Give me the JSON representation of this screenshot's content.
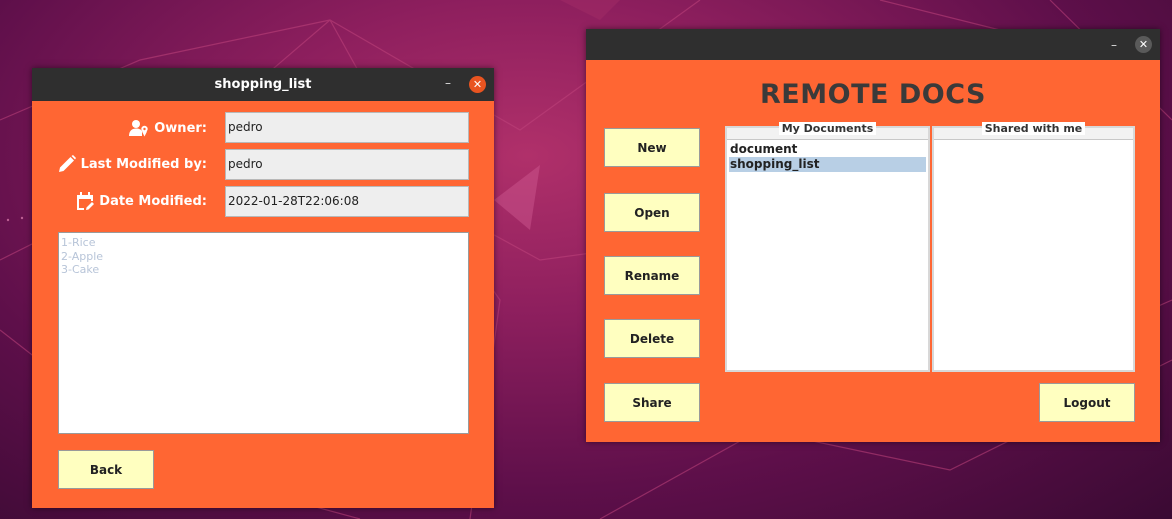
{
  "editor_window": {
    "title": "shopping_list",
    "minimize_label": "–",
    "close_label": "✕",
    "owner_label": "Owner:",
    "owner_value": "pedro",
    "last_modified_by_label": "Last Modified by:",
    "last_modified_by_value": "pedro",
    "date_modified_label": "Date Modified:",
    "date_modified_value": "2022-01-28T22:06:08",
    "content_lines": [
      "1-Rice",
      "2-Apple",
      "3-Cake"
    ],
    "back_label": "Back"
  },
  "docs_window": {
    "minimize_label": "–",
    "close_label": "✕",
    "app_title": "REMOTE DOCS",
    "buttons": {
      "new": "New",
      "open": "Open",
      "rename": "Rename",
      "delete": "Delete",
      "share": "Share",
      "logout": "Logout"
    },
    "my_documents": {
      "header": "My Documents",
      "items": [
        {
          "label": "document",
          "selected": false
        },
        {
          "label": "shopping_list",
          "selected": true
        }
      ]
    },
    "shared_with_me": {
      "header": "Shared with me",
      "items": []
    }
  },
  "colors": {
    "window_bg": "#ff6633",
    "titlebar": "#2f2f2f",
    "button_bg": "#ffffc0",
    "close_active": "#e95420",
    "close_inactive": "#5a5a5a",
    "selection": "#b8cfe5",
    "placeholder_text": "#b7c4d8"
  }
}
